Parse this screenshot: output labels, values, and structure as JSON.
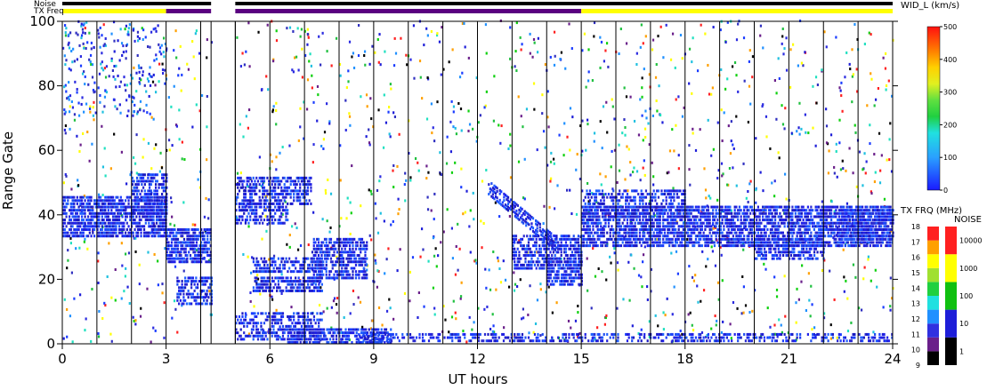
{
  "chart_data": {
    "type": "heatmap",
    "xlabel": "UT hours",
    "ylabel": "Range Gate",
    "xlim": [
      0,
      24
    ],
    "ylim": [
      0,
      100
    ],
    "x_ticks": [
      "0",
      "3",
      "6",
      "9",
      "12",
      "15",
      "18",
      "21",
      "24"
    ],
    "y_ticks": [
      "0",
      "20",
      "40",
      "60",
      "80",
      "100"
    ],
    "top_bar_labels": {
      "noise": "Noise",
      "txfreq": "TX Freq"
    },
    "noise_bar_segments": [
      [
        0,
        4.3
      ],
      [
        5,
        24
      ]
    ],
    "txfreq_bar_segments": [
      {
        "start": 0,
        "end": 3,
        "color": "#ffff00"
      },
      {
        "start": 3,
        "end": 4.3,
        "color": "#5a0080"
      },
      {
        "start": 5,
        "end": 15,
        "color": "#5a0080"
      },
      {
        "start": 15,
        "end": 24,
        "color": "#ffff00"
      }
    ],
    "data_gap_hours": [
      4.3,
      5
    ],
    "colorbars": {
      "width": {
        "title": "WID_L (km/s)",
        "ticks": [
          "0",
          "100",
          "200",
          "300",
          "400",
          "500"
        ],
        "range": [
          0,
          500
        ]
      },
      "txfreq": {
        "title": "TX FRQ (MHz)",
        "ticks": [
          "9",
          "10",
          "11",
          "12",
          "13",
          "14",
          "15",
          "16",
          "17",
          "18"
        ],
        "colors": [
          "#000000",
          "#6a1f8a",
          "#3030e0",
          "#2090ff",
          "#20e0e0",
          "#20d040",
          "#a0e030",
          "#ffff00",
          "#ffa000",
          "#ff2020"
        ]
      },
      "noise": {
        "title": "NOISE",
        "ticks": [
          "1",
          "10",
          "100",
          "1000",
          "10000"
        ],
        "colors": [
          "#000000",
          "#1e1ed8",
          "#10c010",
          "#ffff00",
          "#ff2020"
        ]
      }
    }
  }
}
